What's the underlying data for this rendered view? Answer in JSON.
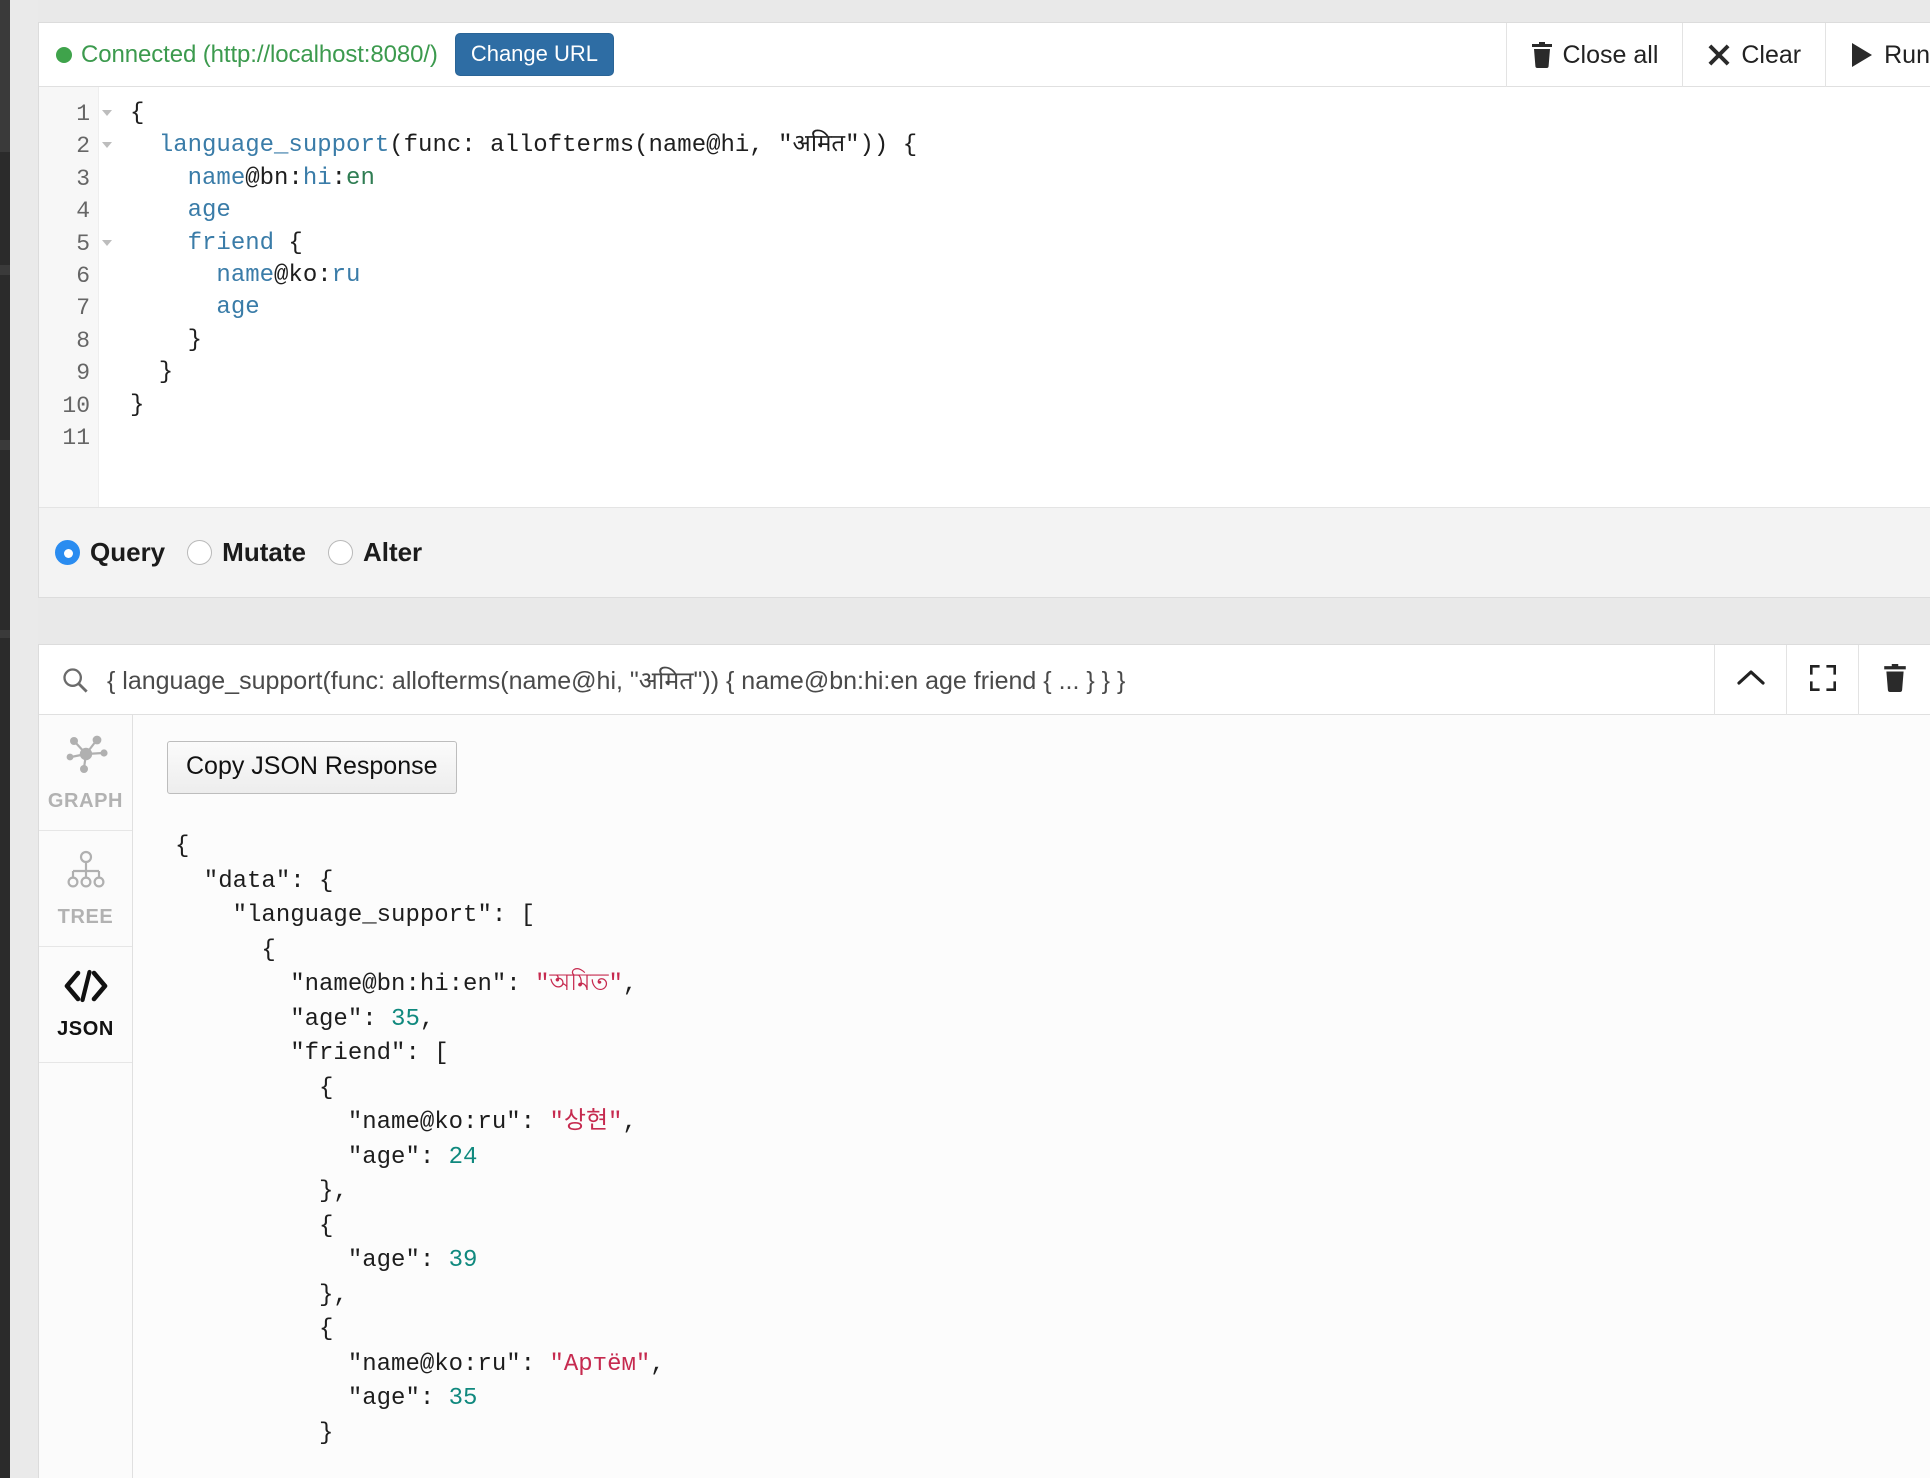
{
  "app": {
    "connection": {
      "status_text": "Connected (http://localhost:8080/)",
      "dot_color": "#3fa34b",
      "change_url_label": "Change URL"
    },
    "toolbar_actions": [
      {
        "label": "Close all",
        "icon": "trash-icon"
      },
      {
        "label": "Clear",
        "icon": "close-x-icon"
      },
      {
        "label": "Run",
        "icon": "play-icon"
      }
    ]
  },
  "editor": {
    "line_numbers": [
      "1",
      "2",
      "3",
      "4",
      "5",
      "6",
      "7",
      "8",
      "9",
      "10",
      "11"
    ],
    "fold_lines": [
      1,
      2,
      5
    ],
    "lines": [
      {
        "n": 1,
        "tokens": [
          {
            "t": "{",
            "c": "plain"
          }
        ]
      },
      {
        "n": 2,
        "tokens": [
          {
            "t": "  ",
            "c": "plain"
          },
          {
            "t": "language_support",
            "c": "attr"
          },
          {
            "t": "(func: allofterms(name@hi, \"अमित\")) {",
            "c": "plain"
          }
        ]
      },
      {
        "n": 3,
        "tokens": [
          {
            "t": "    ",
            "c": "plain"
          },
          {
            "t": "name",
            "c": "attr"
          },
          {
            "t": "@bn:",
            "c": "plain"
          },
          {
            "t": "hi",
            "c": "attr"
          },
          {
            "t": ":",
            "c": "plain"
          },
          {
            "t": "en",
            "c": "green"
          }
        ]
      },
      {
        "n": 4,
        "tokens": [
          {
            "t": "    ",
            "c": "plain"
          },
          {
            "t": "age",
            "c": "attr"
          }
        ]
      },
      {
        "n": 5,
        "tokens": [
          {
            "t": "    ",
            "c": "plain"
          },
          {
            "t": "friend",
            "c": "attr"
          },
          {
            "t": " {",
            "c": "plain"
          }
        ]
      },
      {
        "n": 6,
        "tokens": [
          {
            "t": "      ",
            "c": "plain"
          },
          {
            "t": "name",
            "c": "attr"
          },
          {
            "t": "@ko:",
            "c": "plain"
          },
          {
            "t": "ru",
            "c": "attr"
          }
        ]
      },
      {
        "n": 7,
        "tokens": [
          {
            "t": "      ",
            "c": "plain"
          },
          {
            "t": "age",
            "c": "attr"
          }
        ]
      },
      {
        "n": 8,
        "tokens": [
          {
            "t": "    }",
            "c": "plain"
          }
        ]
      },
      {
        "n": 9,
        "tokens": [
          {
            "t": "  }",
            "c": "plain"
          }
        ]
      },
      {
        "n": 10,
        "tokens": [
          {
            "t": "}",
            "c": "plain"
          }
        ]
      },
      {
        "n": 11,
        "tokens": [
          {
            "t": "",
            "c": "plain"
          }
        ]
      }
    ]
  },
  "mode_selector": {
    "options": [
      {
        "label": "Query",
        "selected": true
      },
      {
        "label": "Mutate",
        "selected": false
      },
      {
        "label": "Alter",
        "selected": false
      }
    ]
  },
  "result": {
    "search_icon": "search-icon",
    "query_summary": "{ language_support(func: allofterms(name@hi, \"अमित\")) { name@bn:hi:en age friend { ... } } }",
    "header_buttons": [
      {
        "name": "collapse-button",
        "icon": "chevron-up-icon"
      },
      {
        "name": "fullscreen-button",
        "icon": "expand-icon"
      },
      {
        "name": "delete-button",
        "icon": "trash-icon"
      }
    ],
    "tabs": [
      {
        "label": "GRAPH",
        "icon": "graph-nodes-icon",
        "active": false
      },
      {
        "label": "TREE",
        "icon": "tree-hierarchy-icon",
        "active": false
      },
      {
        "label": "JSON",
        "icon": "code-brackets-icon",
        "active": true
      }
    ],
    "copy_button_label": "Copy JSON Response",
    "json_lines": [
      [
        {
          "t": "{",
          "c": "key"
        }
      ],
      [
        {
          "t": "  \"data\": {",
          "c": "key"
        }
      ],
      [
        {
          "t": "    \"language_support\": [",
          "c": "key"
        }
      ],
      [
        {
          "t": "      {",
          "c": "key"
        }
      ],
      [
        {
          "t": "        \"name@bn:hi:en\": ",
          "c": "key"
        },
        {
          "t": "\"অমিত\"",
          "c": "str"
        },
        {
          "t": ",",
          "c": "key"
        }
      ],
      [
        {
          "t": "        \"age\": ",
          "c": "key"
        },
        {
          "t": "35",
          "c": "num"
        },
        {
          "t": ",",
          "c": "key"
        }
      ],
      [
        {
          "t": "        \"friend\": [",
          "c": "key"
        }
      ],
      [
        {
          "t": "          {",
          "c": "key"
        }
      ],
      [
        {
          "t": "            \"name@ko:ru\": ",
          "c": "key"
        },
        {
          "t": "\"상현\"",
          "c": "str"
        },
        {
          "t": ",",
          "c": "key"
        }
      ],
      [
        {
          "t": "            \"age\": ",
          "c": "key"
        },
        {
          "t": "24",
          "c": "num"
        }
      ],
      [
        {
          "t": "          },",
          "c": "key"
        }
      ],
      [
        {
          "t": "          {",
          "c": "key"
        }
      ],
      [
        {
          "t": "            \"age\": ",
          "c": "key"
        },
        {
          "t": "39",
          "c": "num"
        }
      ],
      [
        {
          "t": "          },",
          "c": "key"
        }
      ],
      [
        {
          "t": "          {",
          "c": "key"
        }
      ],
      [
        {
          "t": "            \"name@ko:ru\": ",
          "c": "key"
        },
        {
          "t": "\"Артём\"",
          "c": "str"
        },
        {
          "t": ",",
          "c": "key"
        }
      ],
      [
        {
          "t": "            \"age\": ",
          "c": "key"
        },
        {
          "t": "35",
          "c": "num"
        }
      ],
      [
        {
          "t": "          }",
          "c": "key"
        }
      ]
    ]
  },
  "colors": {
    "connected_green": "#3c9a4e",
    "primary_blue": "#2e6da4",
    "radio_blue": "#2a8cf0",
    "json_string": "#c62a4f",
    "json_number": "#10897e",
    "code_attr": "#3a7ca8"
  }
}
